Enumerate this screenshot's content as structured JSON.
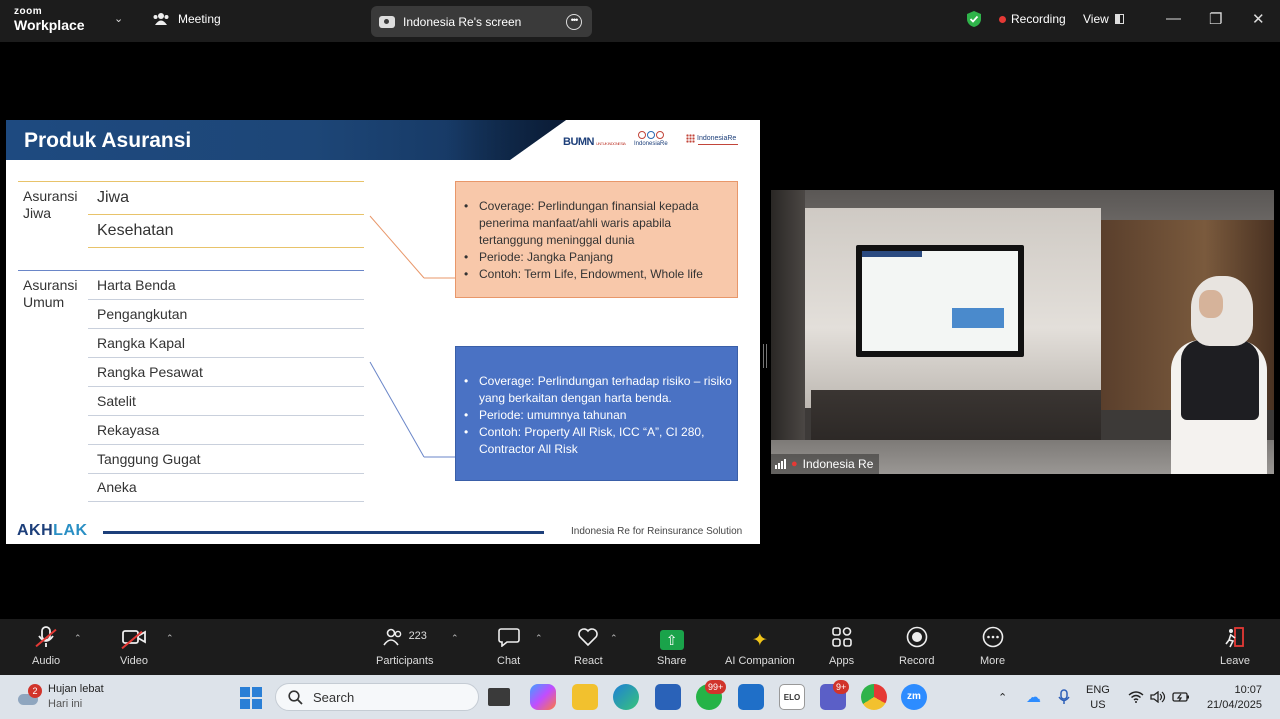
{
  "topbar": {
    "logo_line1": "zoom",
    "logo_line2": "Workplace",
    "meeting_label": "Meeting",
    "screen_share_label": "Indonesia Re's screen",
    "recording_label": "Recording",
    "view_label": "View"
  },
  "slide": {
    "title": "Produk Asuransi",
    "logo_bumn": "BUMN",
    "logo_bumn_sub": "UNTUK INDONESIA",
    "logo_indonesiare": "IndonesiaRe",
    "logo_indonesiare2": "IndonesiaRe",
    "categories": [
      {
        "label": "Asuransi\nJiwa",
        "items": [
          "Jiwa",
          "Kesehatan"
        ]
      },
      {
        "label": "Asuransi\nUmum",
        "items": [
          "Harta Benda",
          "Pengangkutan",
          "Rangka Kapal",
          "Rangka Pesawat",
          "Satelit",
          "Rekayasa",
          "Tanggung Gugat",
          "Aneka"
        ]
      }
    ],
    "box_jiwa": [
      "Coverage: Perlindungan finansial kepada penerima manfaat/ahli waris apabila tertanggung meninggal dunia",
      "Periode: Jangka Panjang",
      "Contoh: Term Life, Endowment, Whole life"
    ],
    "box_umum": [
      "Coverage: Perlindungan terhadap risiko – risiko yang berkaitan dengan harta benda.",
      "Periode: umumnya tahunan",
      "Contoh: Property All Risk, ICC “A”, CI 280, Contractor All Risk"
    ],
    "footer_logo_a": "AKH",
    "footer_logo_b": "LAK",
    "footer_text": "Indonesia Re for Reinsurance Solution"
  },
  "camera": {
    "participant_name": "Indonesia Re"
  },
  "toolbar": {
    "audio": "Audio",
    "video": "Video",
    "participants": "Participants",
    "participants_count": "223",
    "chat": "Chat",
    "react": "React",
    "share": "Share",
    "ai_companion": "AI Companion",
    "apps": "Apps",
    "record": "Record",
    "more": "More",
    "leave": "Leave"
  },
  "taskbar": {
    "weather_badge": "2",
    "weather_title": "Hujan lebat",
    "weather_sub": "Hari ini",
    "search_placeholder": "Search",
    "whatsapp_badge": "99+",
    "teams_badge": "9+",
    "lang_top": "ENG",
    "lang_bottom": "US",
    "time": "10:07",
    "date": "21/04/2025",
    "elo_label": "ELO",
    "zoom_label": "zm"
  }
}
